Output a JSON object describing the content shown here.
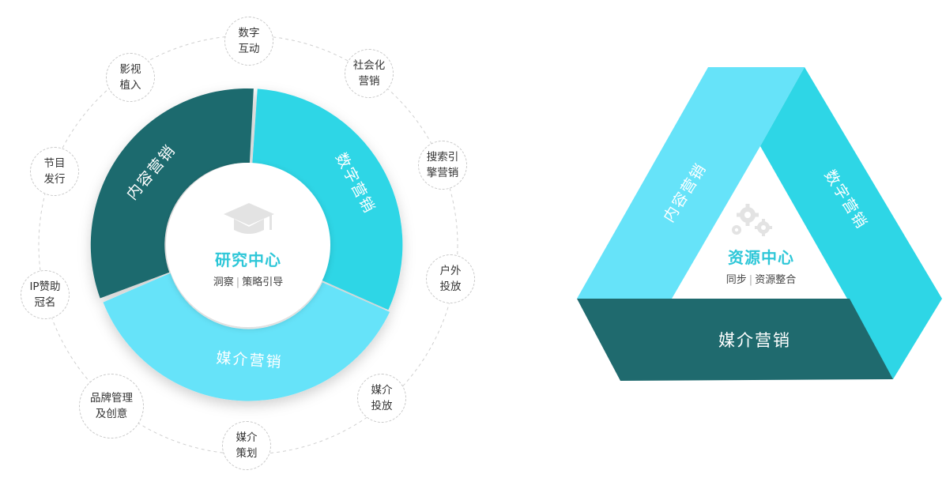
{
  "research_center": {
    "title": "研究中心",
    "sub_a": "洞察",
    "sub_b": "策略引导"
  },
  "ring_segments": {
    "content": "内容营销",
    "digital": "数字营销",
    "media": "媒介营销"
  },
  "satellites": [
    {
      "text": "数字\n互动"
    },
    {
      "text": "社会化\n营销"
    },
    {
      "text": "搜索引\n擎营销"
    },
    {
      "text": "户外\n投放"
    },
    {
      "text": "媒介\n投放"
    },
    {
      "text": "媒介\n策划"
    },
    {
      "text": "品牌管理\n及创意"
    },
    {
      "text": "IP赞助\n冠名"
    },
    {
      "text": "节目\n发行"
    },
    {
      "text": "影视\n植入"
    }
  ],
  "resource_center": {
    "title": "资源中心",
    "sub_a": "同步",
    "sub_b": "资源整合"
  },
  "triangle_sides": {
    "left": "内容营销",
    "right": "数字营销",
    "bottom": "媒介营销"
  },
  "icons": {
    "cap": "graduation-cap-icon",
    "gears": "gears-icon"
  },
  "colors": {
    "dark_teal": "#1f6a6e",
    "cyan": "#2ed6e6",
    "light_cyan": "#66e3f9",
    "accent_text": "#2ec7d8"
  }
}
